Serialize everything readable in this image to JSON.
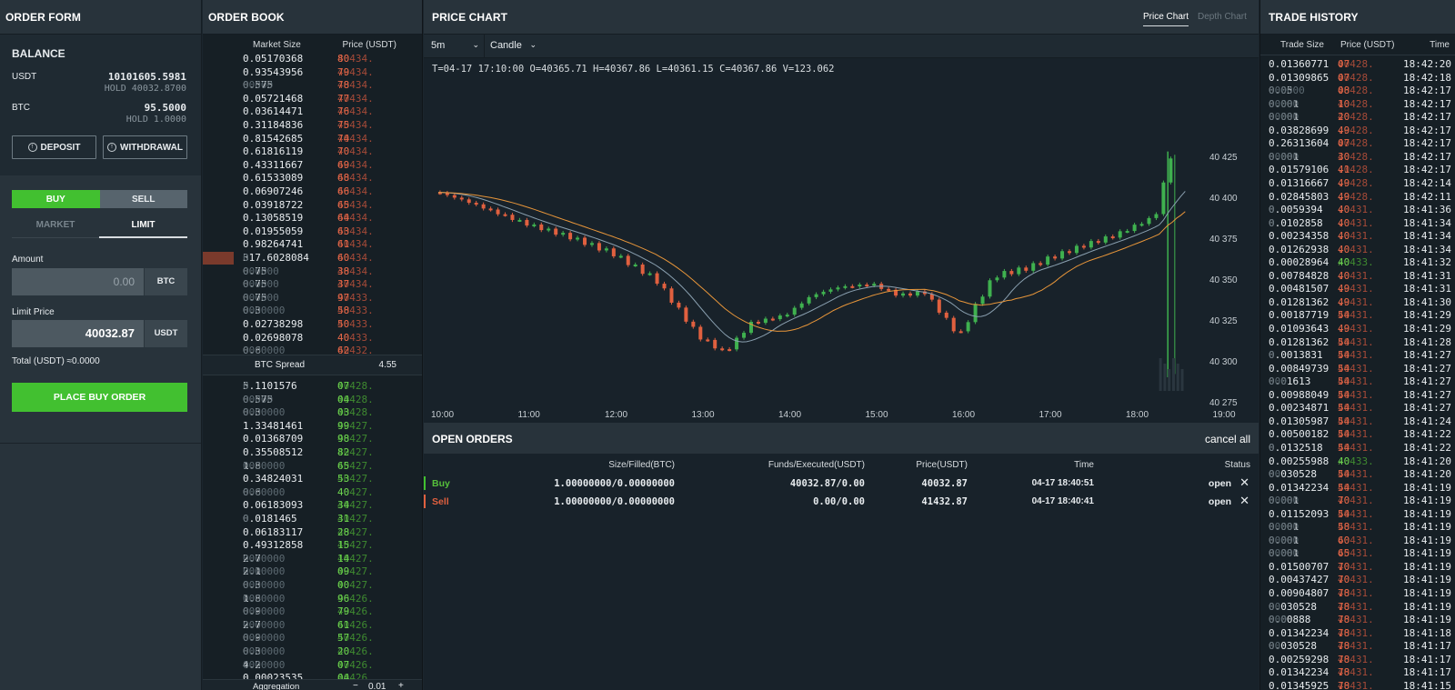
{
  "order_form": {
    "title": "ORDER FORM",
    "balance_title": "BALANCE",
    "usdt_label": "USDT",
    "usdt_value": "10101605.5981",
    "usdt_hold": "HOLD 40032.8700",
    "btc_label": "BTC",
    "btc_value": "95.5000",
    "btc_hold": "HOLD 1.0000",
    "deposit": "DEPOSIT",
    "withdrawal": "WITHDRAWAL",
    "buy": "BUY",
    "sell": "SELL",
    "market": "MARKET",
    "limit": "LIMIT",
    "amount_label": "Amount",
    "amount_placeholder": "0.00",
    "amount_unit": "BTC",
    "limit_label": "Limit Price",
    "limit_value": "40032.87",
    "limit_unit": "USDT",
    "total": "Total (USDT) ≈0.0000",
    "place": "PLACE BUY ORDER"
  },
  "order_book": {
    "title": "ORDER BOOK",
    "col_size": "Market Size",
    "col_price": "Price (USDT)",
    "asks": [
      [
        "0.05170368",
        "",
        "40434.",
        "80"
      ],
      [
        "0.93543956",
        "",
        "40434.",
        "79"
      ],
      [
        "0.575",
        "00000",
        "40434.",
        "78"
      ],
      [
        "0.05721468",
        "",
        "40434.",
        "77"
      ],
      [
        "0.03614471",
        "",
        "40434.",
        "76"
      ],
      [
        "0.31184836",
        "",
        "40434.",
        "75"
      ],
      [
        "0.81542685",
        "",
        "40434.",
        "74"
      ],
      [
        "0.61816119",
        "",
        "40434.",
        "70"
      ],
      [
        "0.43311667",
        "",
        "40434.",
        "69"
      ],
      [
        "0.61533089",
        "",
        "40434.",
        "68"
      ],
      [
        "0.06907246",
        "",
        "40434.",
        "66"
      ],
      [
        "0.03918722",
        "",
        "40434.",
        "65"
      ],
      [
        "0.13058519",
        "",
        "40434.",
        "64"
      ],
      [
        "0.01955059",
        "",
        "40434.",
        "63"
      ],
      [
        "0.98264741",
        "",
        "40434.",
        "61"
      ],
      [
        "317.6028084",
        "0",
        "40434.",
        "60"
      ],
      [
        "0.75",
        "000000",
        "40434.",
        "38"
      ],
      [
        "0.75",
        "000000",
        "40434.",
        "37"
      ],
      [
        "0.75",
        "000000",
        "40433.",
        "97"
      ],
      [
        "0.3",
        "0000000",
        "40433.",
        "58"
      ],
      [
        "0.02738298",
        "",
        "40433.",
        "50"
      ],
      [
        "0.02698078",
        "",
        "40433.",
        "40"
      ],
      [
        "0.6",
        "0000000",
        "40432.",
        "62"
      ]
    ],
    "spread_label": "BTC Spread",
    "spread_value": "4.55",
    "bids": [
      [
        "5.1101576",
        "0",
        "40428.",
        "07"
      ],
      [
        "0.575",
        "00000",
        "40428.",
        "04"
      ],
      [
        "0.3",
        "0000000",
        "40428.",
        "03"
      ],
      [
        "1.33481461",
        "",
        "40427.",
        "99"
      ],
      [
        "0.01368709",
        "",
        "40427.",
        "98"
      ],
      [
        "0.35508512",
        "",
        "40427.",
        "82"
      ],
      [
        "1.8",
        "0000000",
        "40427.",
        "65"
      ],
      [
        "0.34824031",
        "",
        "40427.",
        "53"
      ],
      [
        "0.6",
        "0000000",
        "40427.",
        "40"
      ],
      [
        "0.06183093",
        "",
        "40427.",
        "34"
      ],
      [
        "0.0181465",
        "0",
        "40427.",
        "31"
      ],
      [
        "0.06183117",
        "",
        "40427.",
        "28"
      ],
      [
        "0.49312858",
        "",
        "40427.",
        "15"
      ],
      [
        "2.7",
        "0000000",
        "40427.",
        "14"
      ],
      [
        "2.1",
        "0000000",
        "40427.",
        "09"
      ],
      [
        "0.3",
        "0000000",
        "40427.",
        "00"
      ],
      [
        "1.8",
        "0000000",
        "40426.",
        "96"
      ],
      [
        "0.9",
        "0000000",
        "40426.",
        "79"
      ],
      [
        "2.7",
        "0000000",
        "40426.",
        "61"
      ],
      [
        "0.9",
        "0000000",
        "40426.",
        "57"
      ],
      [
        "0.3",
        "0000000",
        "40426.",
        "20"
      ],
      [
        "4.2",
        "0000000",
        "40426.",
        "07"
      ],
      [
        "0.00023535",
        "",
        "40426.",
        "04"
      ]
    ],
    "aggregation_label": "Aggregation",
    "aggregation_value": "0.01",
    "minus": "−",
    "plus": "+"
  },
  "chart": {
    "title": "PRICE CHART",
    "tab_price": "Price Chart",
    "tab_depth": "Depth Chart",
    "interval": "5m",
    "type": "Candle",
    "ohlc_text": "T=04-17 17:10:00  O=40365.71  H=40367.86  L=40361.15  C=40367.86  V=123.062",
    "y_ticks": [
      "40 425",
      "40 400",
      "40 375",
      "40 350",
      "40 325",
      "40 300",
      "40 275"
    ],
    "x_ticks": [
      "10:00",
      "11:00",
      "12:00",
      "13:00",
      "14:00",
      "15:00",
      "16:00",
      "17:00",
      "18:00",
      "19:00"
    ],
    "colors": {
      "up": "#3fb14f",
      "down": "#e0603f",
      "ma1": "#e8963a",
      "ma2": "#8aa0b0"
    }
  },
  "open_orders": {
    "title": "OPEN ORDERS",
    "cancel_all": "cancel all",
    "headers": [
      "Size/Filled(BTC)",
      "Funds/Executed(USDT)",
      "Price(USDT)",
      "Time",
      "Status"
    ],
    "rows": [
      {
        "side": "Buy",
        "size": "1.00000000/0.00000000",
        "funds": "40032.87/0.00",
        "price": "40032.87",
        "time": "04-17 18:40:51",
        "status": "open"
      },
      {
        "side": "Sell",
        "size": "1.00000000/0.00000000",
        "funds": "0.00/0.00",
        "price": "41432.87",
        "time": "04-17 18:40:41",
        "status": "open"
      }
    ]
  },
  "trade_history": {
    "title": "TRADE HISTORY",
    "col_size": "Trade Size",
    "col_price": "Price (USDT)",
    "col_time": "Time",
    "rows": [
      [
        "0.01360771",
        "",
        "40428.",
        "07",
        "18:42:20",
        "d"
      ],
      [
        "0.01309865",
        "",
        "40428.",
        "07",
        "18:42:18",
        "d"
      ],
      [
        "0.05",
        "000000",
        "40428.",
        "08",
        "18:42:17",
        "d"
      ],
      [
        "0.001",
        "00000",
        "40428.",
        "10",
        "18:42:17",
        "d"
      ],
      [
        "0.001",
        "00000",
        "40428.",
        "20",
        "18:42:17",
        "d"
      ],
      [
        "0.03828699",
        "",
        "40428.",
        "49",
        "18:42:17",
        "d"
      ],
      [
        "0.26313604",
        "",
        "40428.",
        "07",
        "18:42:17",
        "d"
      ],
      [
        "0.001",
        "00000",
        "40428.",
        "30",
        "18:42:17",
        "d"
      ],
      [
        "0.01579106",
        "",
        "40428.",
        "41",
        "18:42:17",
        "d"
      ],
      [
        "0.01316667",
        "",
        "40428.",
        "49",
        "18:42:14",
        "d"
      ],
      [
        "0.02845803",
        "",
        "40428.",
        "49",
        "18:42:11",
        "d"
      ],
      [
        "0.0059394",
        "0",
        "40431.",
        "40",
        "18:41:36",
        "d"
      ],
      [
        "0.0102858",
        "0",
        "40431.",
        "40",
        "18:41:34",
        "d"
      ],
      [
        "0.00234358",
        "",
        "40431.",
        "40",
        "18:41:34",
        "d"
      ],
      [
        "0.01262938",
        "",
        "40431.",
        "40",
        "18:41:34",
        "d"
      ],
      [
        "0.00028964",
        "",
        "40433.",
        "40",
        "18:41:32",
        "u"
      ],
      [
        "0.00784828",
        "",
        "40431.",
        "40",
        "18:41:31",
        "d"
      ],
      [
        "0.00481507",
        "",
        "40431.",
        "49",
        "18:41:31",
        "d"
      ],
      [
        "0.01281362",
        "",
        "40431.",
        "49",
        "18:41:30",
        "d"
      ],
      [
        "0.00187719",
        "",
        "40431.",
        "54",
        "18:41:29",
        "d"
      ],
      [
        "0.01093643",
        "",
        "40431.",
        "49",
        "18:41:29",
        "d"
      ],
      [
        "0.01281362",
        "",
        "40431.",
        "54",
        "18:41:28",
        "d"
      ],
      [
        "0.0013831",
        "0",
        "40431.",
        "54",
        "18:41:27",
        "d"
      ],
      [
        "0.00849739",
        "",
        "40431.",
        "54",
        "18:41:27",
        "d"
      ],
      [
        "0.01613",
        "000",
        "40431.",
        "54",
        "18:41:27",
        "d"
      ],
      [
        "0.00988049",
        "",
        "40431.",
        "54",
        "18:41:27",
        "d"
      ],
      [
        "0.00234871",
        "",
        "40431.",
        "54",
        "18:41:27",
        "d"
      ],
      [
        "0.01305987",
        "",
        "40431.",
        "54",
        "18:41:24",
        "d"
      ],
      [
        "0.00500182",
        "",
        "40431.",
        "54",
        "18:41:22",
        "d"
      ],
      [
        "0.0132518",
        "0",
        "40431.",
        "54",
        "18:41:22",
        "d"
      ],
      [
        "0.00255988",
        "",
        "40433.",
        "40",
        "18:41:20",
        "u"
      ],
      [
        "0.030528",
        "00",
        "40431.",
        "54",
        "18:41:20",
        "d"
      ],
      [
        "0.01342234",
        "",
        "40431.",
        "54",
        "18:41:19",
        "d"
      ],
      [
        "0.001",
        "00000",
        "40431.",
        "70",
        "18:41:19",
        "d"
      ],
      [
        "0.01152093",
        "",
        "40431.",
        "54",
        "18:41:19",
        "d"
      ],
      [
        "0.001",
        "00000",
        "40431.",
        "58",
        "18:41:19",
        "d"
      ],
      [
        "0.001",
        "00000",
        "40431.",
        "60",
        "18:41:19",
        "d"
      ],
      [
        "0.001",
        "00000",
        "40431.",
        "65",
        "18:41:19",
        "d"
      ],
      [
        "0.01500707",
        "",
        "40431.",
        "70",
        "18:41:19",
        "d"
      ],
      [
        "0.00437427",
        "",
        "40431.",
        "70",
        "18:41:19",
        "d"
      ],
      [
        "0.00904807",
        "",
        "40431.",
        "78",
        "18:41:19",
        "d"
      ],
      [
        "0.030528",
        "00",
        "40431.",
        "78",
        "18:41:19",
        "d"
      ],
      [
        "0.00888",
        "000",
        "40431.",
        "78",
        "18:41:19",
        "d"
      ],
      [
        "0.01342234",
        "",
        "40431.",
        "78",
        "18:41:18",
        "d"
      ],
      [
        "0.030528",
        "00",
        "40431.",
        "78",
        "18:41:17",
        "d"
      ],
      [
        "0.00259298",
        "",
        "40431.",
        "78",
        "18:41:17",
        "d"
      ],
      [
        "0.01342234",
        "",
        "40431.",
        "78",
        "18:41:17",
        "d"
      ],
      [
        "0.01345925",
        "",
        "40431.",
        "78",
        "18:41:15",
        "d"
      ]
    ]
  }
}
